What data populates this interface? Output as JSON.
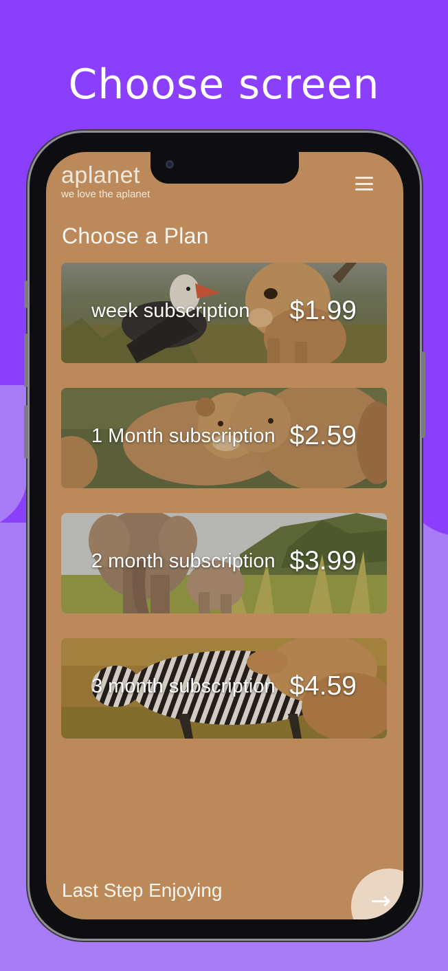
{
  "headline": "Choose screen",
  "app": {
    "brand_name": "aplanet",
    "brand_tagline": "we love the aplanet",
    "menu_icon": "hamburger-menu-icon"
  },
  "section_title": "Choose a Plan",
  "plans": [
    {
      "name": "week subscription",
      "price": "$1.99",
      "image": "bird-and-lion-cub-photo"
    },
    {
      "name": "1 Month subscription",
      "price": "$2.59",
      "image": "lion-cubs-photo"
    },
    {
      "name": "2 month subscription",
      "price": "$3.99",
      "image": "elephants-photo"
    },
    {
      "name": "3 month subscription",
      "price": "$4.59",
      "image": "zebra-and-lion-photo"
    }
  ],
  "footer_text": "Last Step Enjoying",
  "next_icon": "arrow-right-icon",
  "colors": {
    "page_bg_top": "#8a3ffc",
    "page_bg_bottom": "#a87cf6",
    "screen_bg": "#bc8a5a"
  }
}
